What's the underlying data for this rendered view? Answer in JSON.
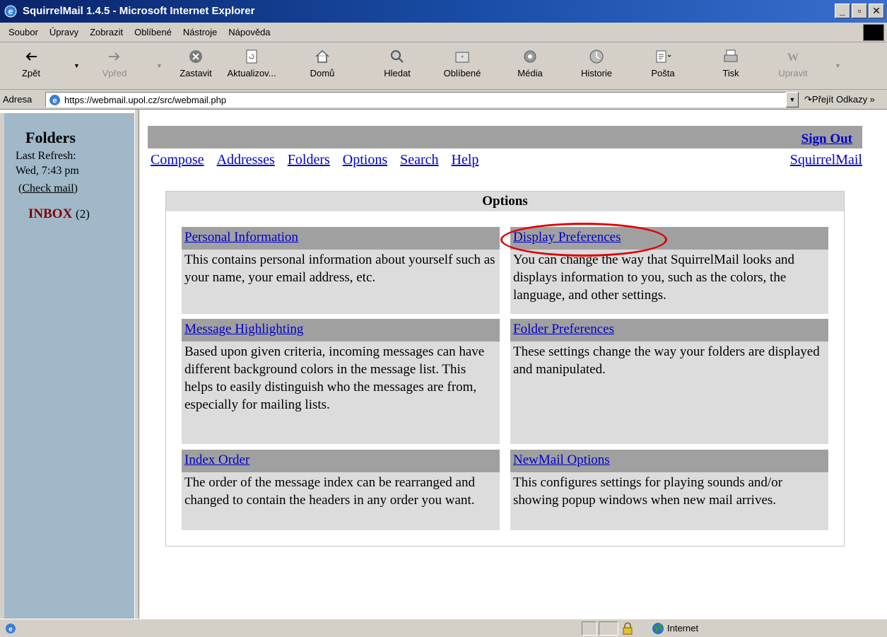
{
  "window": {
    "title": "SquirrelMail 1.4.5 - Microsoft Internet Explorer",
    "min_label": "_",
    "max_label": "▫",
    "close_label": "✕"
  },
  "menubar": {
    "items": [
      "Soubor",
      "Úpravy",
      "Zobrazit",
      "Oblíbené",
      "Nástroje",
      "Nápověda"
    ]
  },
  "toolbar": {
    "back": "Zpět",
    "forward": "Vpřed",
    "stop": "Zastavit",
    "refresh": "Aktualizov...",
    "home": "Domů",
    "search": "Hledat",
    "favorites": "Oblíbené",
    "media": "Média",
    "history": "Historie",
    "mail": "Pošta",
    "print": "Tisk",
    "edit": "Upravit"
  },
  "addressbar": {
    "label": "Adresa",
    "url": "https://webmail.upol.cz/src/webmail.php",
    "go": "Přejít",
    "links": "Odkazy »"
  },
  "left": {
    "title": "Folders",
    "last_refresh_label": "Last Refresh:",
    "last_refresh_time": "Wed, 7:43 pm",
    "check_mail": "Check mail",
    "inbox_name": "INBOX",
    "inbox_count": "(2)"
  },
  "main": {
    "sign_out": "Sign Out",
    "nav": [
      "Compose",
      "Addresses",
      "Folders",
      "Options",
      "Search",
      "Help"
    ],
    "brand_link": "SquirrelMail",
    "options_title": "Options",
    "options": [
      {
        "title": "Personal Information",
        "desc": "This contains personal information about yourself such as your name, your email address, etc."
      },
      {
        "title": "Display Preferences",
        "desc": "You can change the way that SquirrelMail looks and displays information to you, such as the colors, the language, and other settings."
      },
      {
        "title": "Message Highlighting",
        "desc": "Based upon given criteria, incoming messages can have different background colors in the message list. This helps to easily distinguish who the messages are from, especially for mailing lists."
      },
      {
        "title": "Folder Preferences",
        "desc": "These settings change the way your folders are displayed and manipulated."
      },
      {
        "title": "Index Order",
        "desc": "The order of the message index can be rearranged and changed to contain the headers in any order you want."
      },
      {
        "title": "NewMail Options",
        "desc": "This configures settings for playing sounds and/or showing popup windows when new mail arrives."
      }
    ]
  },
  "statusbar": {
    "zone": "Internet"
  },
  "colors": {
    "title_bar": "#0a246a",
    "link": "#0000cc",
    "inbox": "#800000",
    "left_frame": "#a0b8c8",
    "highlight": "#e00000"
  }
}
